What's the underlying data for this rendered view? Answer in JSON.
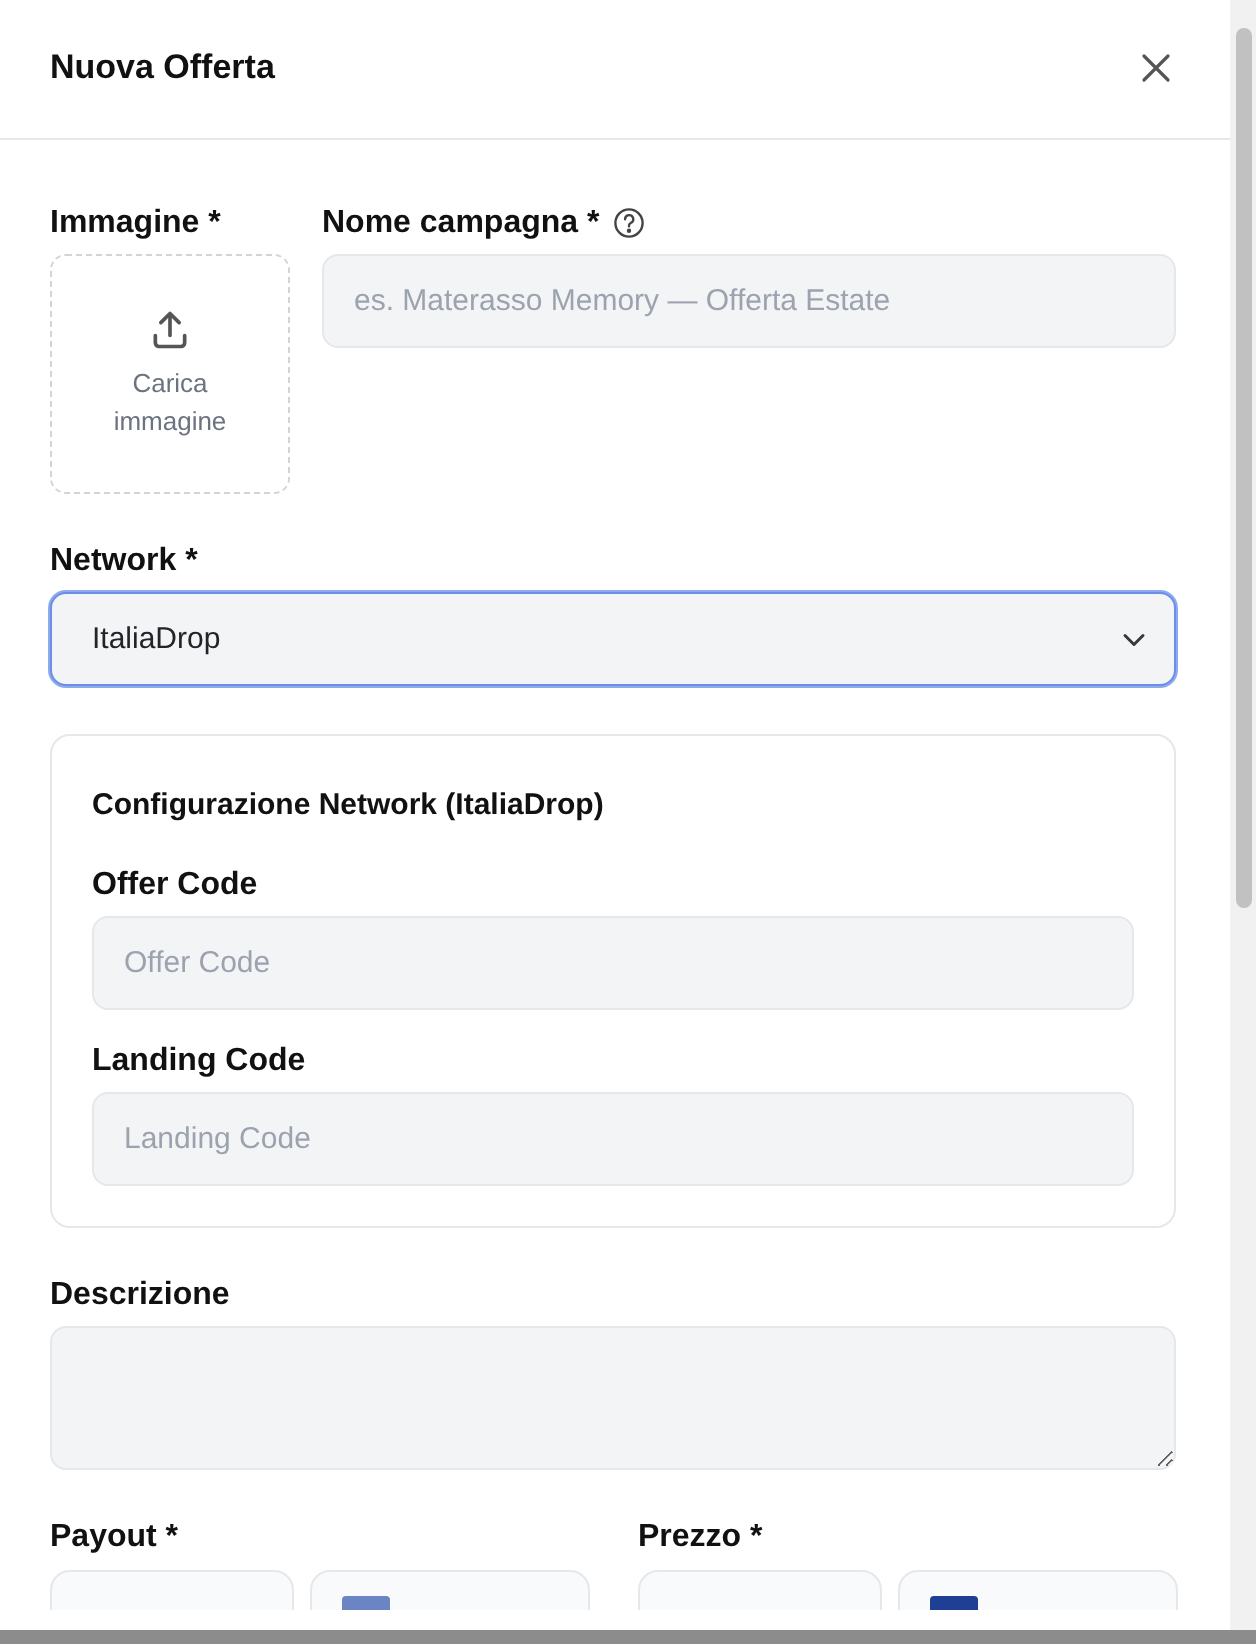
{
  "dialog": {
    "title": "Nuova Offerta"
  },
  "image": {
    "label": "Immagine *",
    "upload_text": "Carica immagine"
  },
  "campaign": {
    "label": "Nome campagna *",
    "placeholder": "es. Materasso Memory — Offerta Estate"
  },
  "network": {
    "label": "Network *",
    "value": "ItaliaDrop",
    "focused": true
  },
  "config": {
    "title": "Configurazione Network (ItaliaDrop)",
    "fields": [
      {
        "label": "Offer Code",
        "placeholder": "Offer Code"
      },
      {
        "label": "Landing Code",
        "placeholder": "Landing Code"
      }
    ]
  },
  "description": {
    "label": "Descrizione"
  },
  "prices": [
    {
      "label": "Payout *",
      "color": "#6b85c4"
    },
    {
      "label": "Prezzo *",
      "color": "#1f3f94"
    }
  ]
}
